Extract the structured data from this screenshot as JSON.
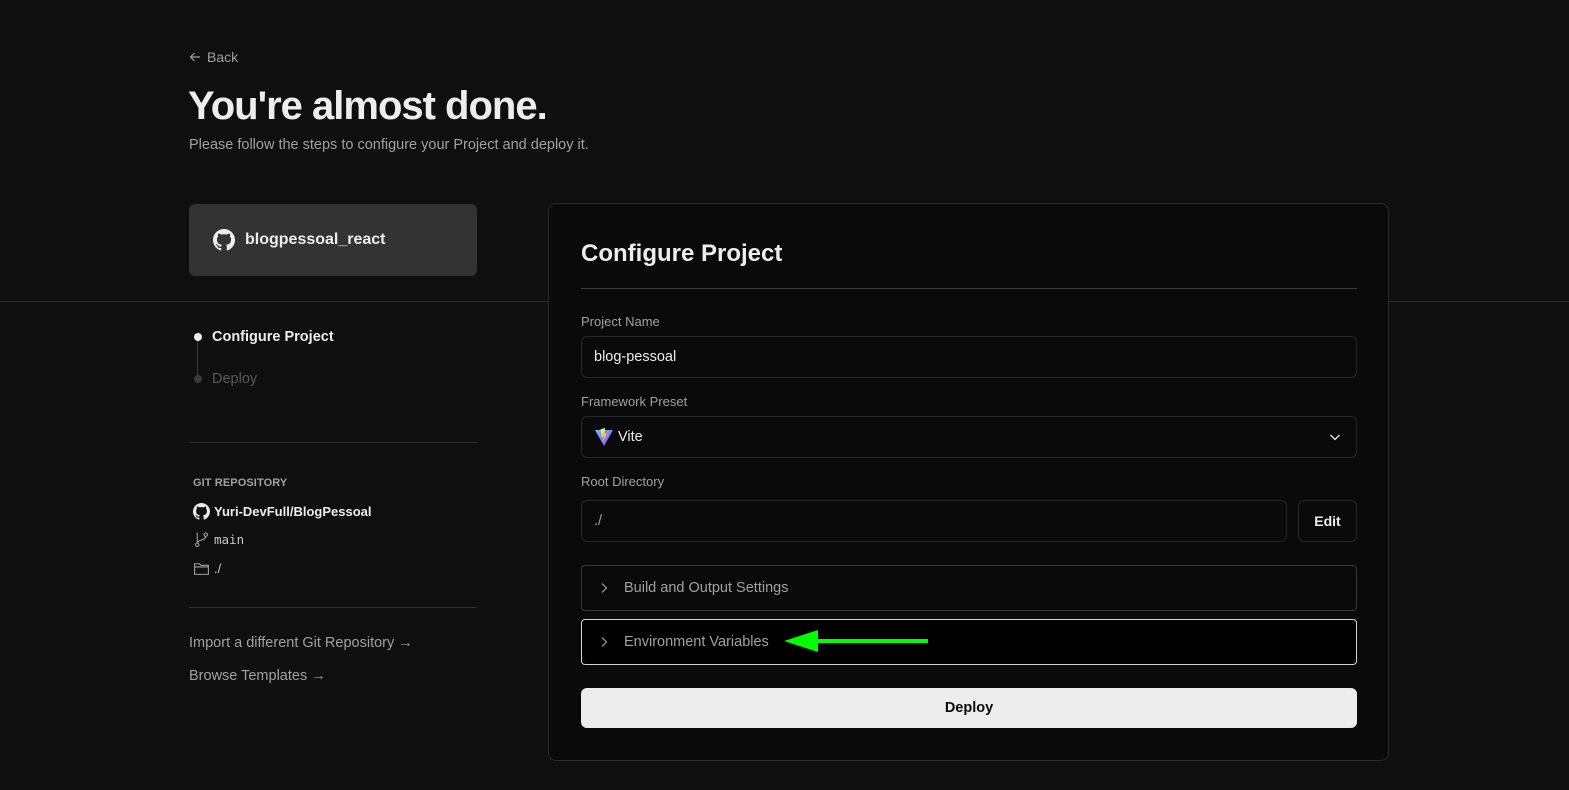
{
  "nav": {
    "back_label": "Back"
  },
  "header": {
    "title": "You're almost done.",
    "subtitle": "Please follow the steps to configure your Project and deploy it."
  },
  "repo_card": {
    "name": "blogpessoal_react",
    "icon": "github-icon"
  },
  "steps": [
    {
      "label": "Configure Project",
      "state": "active"
    },
    {
      "label": "Deploy",
      "state": "inactive"
    }
  ],
  "git": {
    "heading": "GIT REPOSITORY",
    "repo": "Yuri-DevFull/BlogPessoal",
    "branch": "main",
    "directory": "./"
  },
  "links": {
    "import_repo": "Import a different Git Repository →",
    "browse_templates": "Browse Templates →"
  },
  "panel": {
    "title": "Configure Project",
    "project_name_label": "Project Name",
    "project_name_value": "blog-pessoal",
    "framework_label": "Framework Preset",
    "framework_value": "Vite",
    "root_label": "Root Directory",
    "root_value": "./",
    "edit_label": "Edit",
    "build_settings_label": "Build and Output Settings",
    "env_vars_label": "Environment Variables",
    "deploy_label": "Deploy"
  },
  "colors": {
    "background": "#0f0f0f",
    "panel": "#0a0a0a",
    "text": "#ededed",
    "muted": "#a1a1a1",
    "annotation_arrow": "#00ff00"
  }
}
